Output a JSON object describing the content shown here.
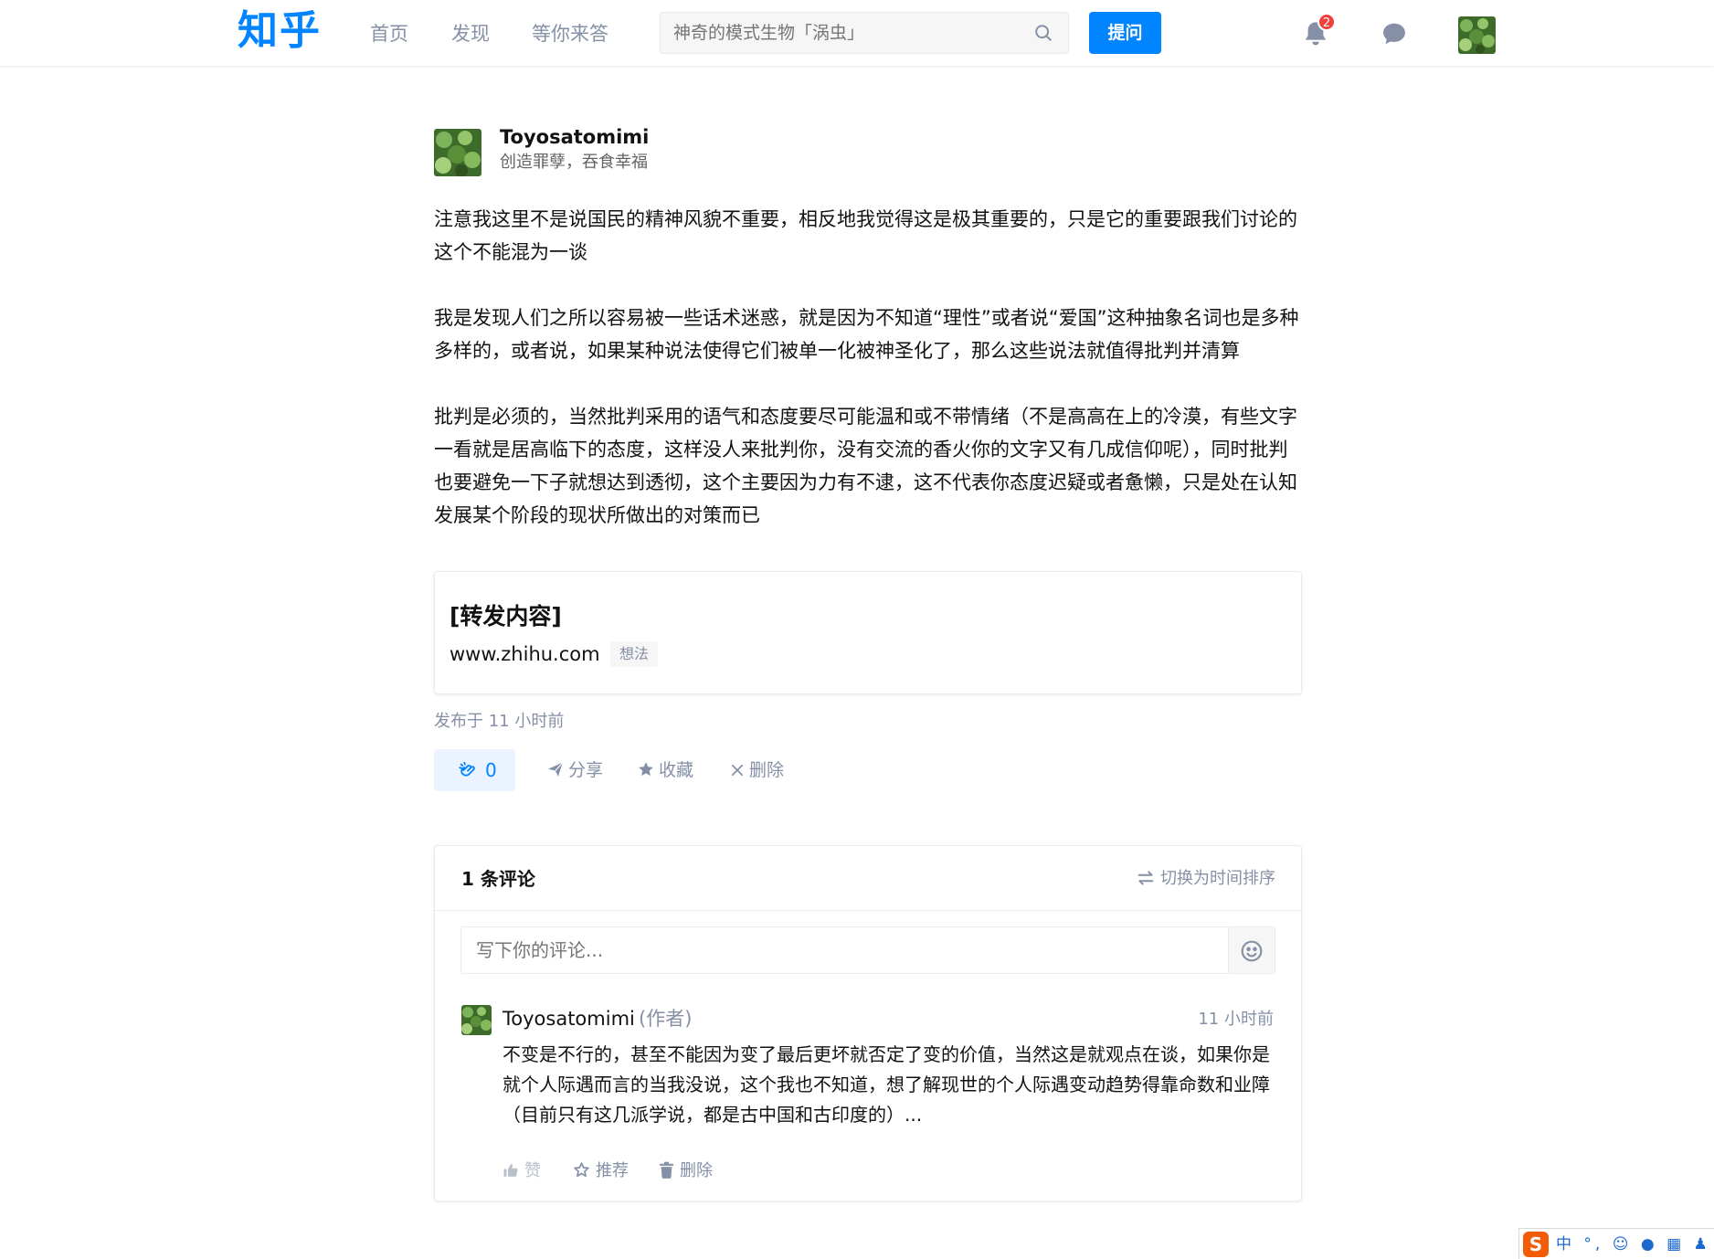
{
  "header": {
    "logo": "知乎",
    "nav": [
      "首页",
      "发现",
      "等你来答"
    ],
    "search_placeholder": "神奇的模式生物「涡虫」",
    "ask_label": "提问",
    "notification_count": "2",
    "brand_color": "#0084ff"
  },
  "post": {
    "author": "Toyosatomimi",
    "headline": "创造罪孽，吞食幸福",
    "paragraphs": [
      "注意我这里不是说国民的精神风貌不重要，相反地我觉得这是极其重要的，只是它的重要跟我们讨论的这个不能混为一谈",
      "我是发现人们之所以容易被一些话术迷惑，就是因为不知道“理性”或者说“爱国”这种抽象名词也是多种多样的，或者说，如果某种说法使得它们被单一化被神圣化了，那么这些说法就值得批判并清算",
      "批判是必须的，当然批判采用的语气和态度要尽可能温和或不带情绪（不是高高在上的冷漠，有些文字一看就是居高临下的态度，这样没人来批判你，没有交流的香火你的文字又有几成信仰呢），同时批判也要避免一下子就想达到透彻，这个主要因为力有不逮，这不代表你态度迟疑或者惫懒，只是处在认知发展某个阶段的现状所做出的对策而已"
    ],
    "repost": {
      "title": "[转发内容]",
      "url": "www.zhihu.com",
      "tag": "想法"
    },
    "published": "发布于 11 小时前",
    "like_count": "0",
    "actions": {
      "share": "分享",
      "collect": "收藏",
      "delete": "删除"
    }
  },
  "comments": {
    "count_label": "1 条评论",
    "sort_label": "切换为时间排序",
    "input_placeholder": "写下你的评论...",
    "items": [
      {
        "author": "Toyosatomimi",
        "author_tag": "(作者)",
        "time": "11 小时前",
        "text": "不变是不行的，甚至不能因为变了最后更坏就否定了变的价值，当然这是就观点在谈，如果你是就个人际遇而言的当我没说，这个我也不知道，想了解现世的个人际遇变动趋势得靠命数和业障（目前只有这几派学说，都是古中国和古印度的）...",
        "actions": {
          "like": "赞",
          "recommend": "推荐",
          "delete": "删除"
        }
      }
    ]
  },
  "ime": {
    "logo": "S",
    "items": "中 °, ☺ ● ▦ ♟"
  }
}
